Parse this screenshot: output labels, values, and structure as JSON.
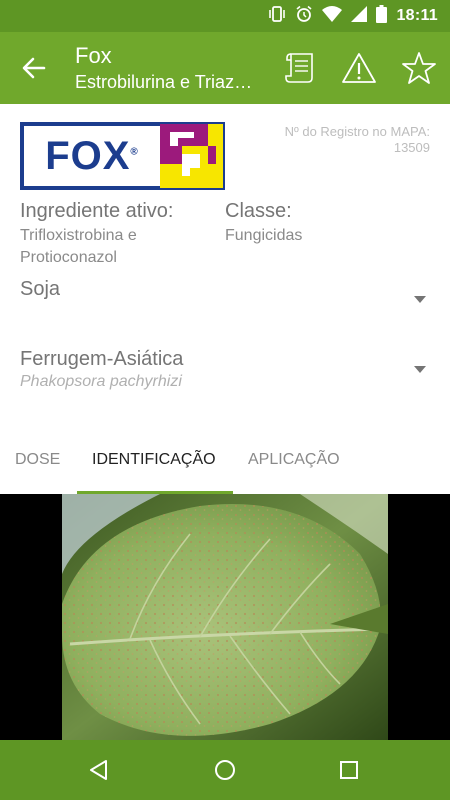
{
  "status_bar": {
    "time": "18:11",
    "icons": [
      "vibrate-icon",
      "alarm-icon",
      "wifi-icon",
      "signal-icon",
      "battery-icon"
    ]
  },
  "app_bar": {
    "title": "Fox",
    "subtitle": "Estrobilurina e Triaz…",
    "actions": [
      "document-icon",
      "warning-icon",
      "star-icon"
    ]
  },
  "product": {
    "logo_text": "FOX",
    "logo_reg": "®",
    "registro_label": "Nº do Registro no MAPA:",
    "registro_value": "13509",
    "ingrediente_label": "Ingrediente ativo:",
    "ingrediente_value": "Trifloxistrobina e Protioconazol",
    "classe_label": "Classe:",
    "classe_value": "Fungicidas"
  },
  "crop_select": {
    "value": "Soja"
  },
  "pest_select": {
    "value": "Ferrugem-Asiática",
    "scientific": "Phakopsora pachyrhizi"
  },
  "tabs": [
    {
      "label": "DOSE",
      "active": false
    },
    {
      "label": "IDENTIFICAÇÃO",
      "active": true
    },
    {
      "label": "APLICAÇÃO",
      "active": false
    }
  ],
  "colors": {
    "status_bar": "#5e9624",
    "app_bar": "#70a82c",
    "logo_blue": "#1c3d8e",
    "logo_magenta": "#9c1a7c",
    "logo_yellow": "#f7e600"
  }
}
